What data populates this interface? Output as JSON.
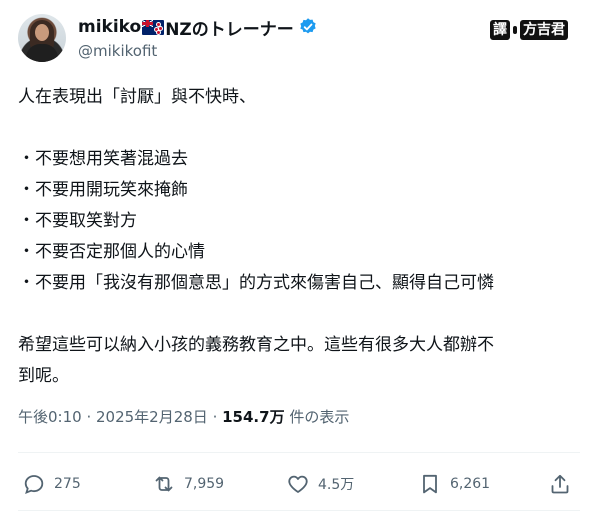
{
  "author": {
    "display_name_prefix": "mikiko",
    "display_name_suffix": "NZのトレーナー",
    "handle": "@mikikofit",
    "flag_icon": "new-zealand-flag-icon",
    "verified_color": "#1d9bf0"
  },
  "brand": {
    "part1": "譯",
    "part2": "方吉君"
  },
  "tweet": {
    "lines": [
      "人在表現出「討厭」與不快時、",
      "",
      "・不要想用笑著混過去",
      "・不要用開玩笑來掩飾",
      "・不要取笑對方",
      "・不要否定那個人的心情",
      "・不要用「我沒有那個意思」的方式來傷害自己、顯得自己可憐",
      "",
      "希望這些可以納入小孩的義務教育之中。這些有很多大人都辦不",
      "到呢。"
    ]
  },
  "meta": {
    "time": "午後0:10",
    "sep1": " · ",
    "date": "2025年2月28日",
    "sep2": " · ",
    "views": "154.7万",
    "views_label": " 件の表示"
  },
  "actions": {
    "replies": "275",
    "reposts": "7,959",
    "likes": "4.5万",
    "bookmarks": "6,261"
  }
}
